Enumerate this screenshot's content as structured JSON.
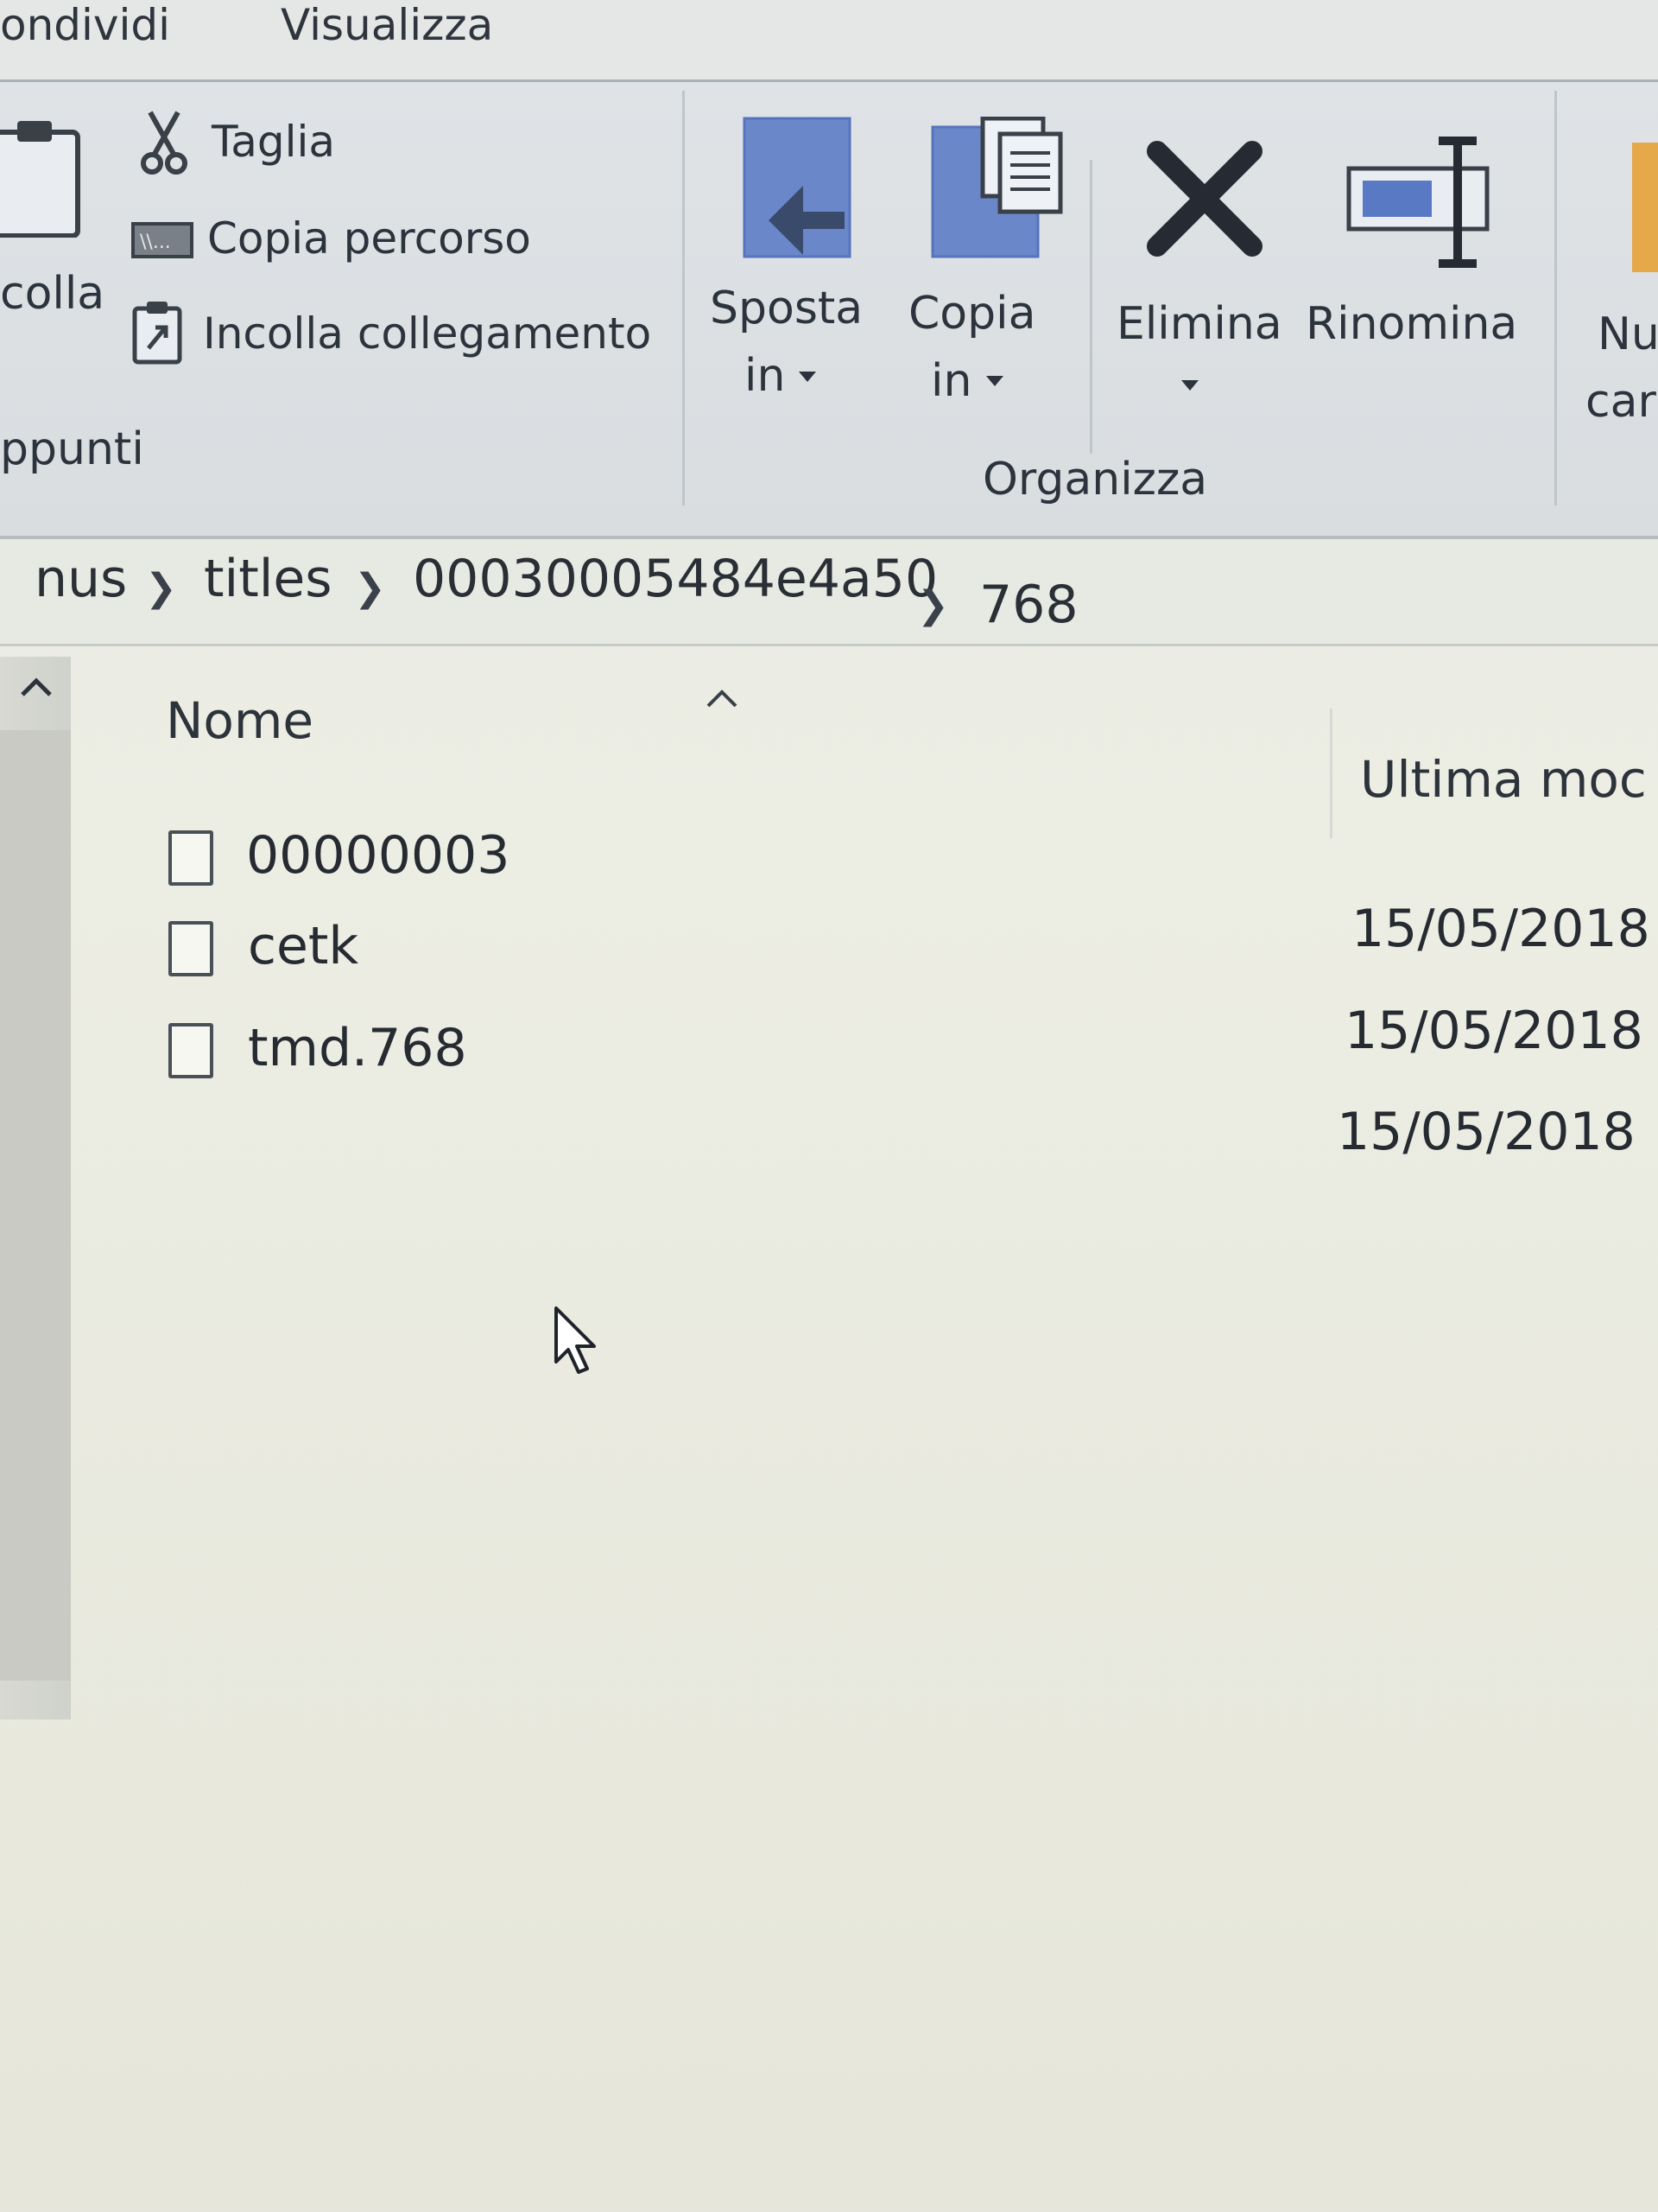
{
  "tabs": [
    {
      "label": "ondividi"
    },
    {
      "label": "Visualizza"
    }
  ],
  "ribbon": {
    "clipboard": {
      "paste_label": "colla",
      "cut_label": "Taglia",
      "copy_path_label": "Copia percorso",
      "paste_shortcut_label": "Incolla collegamento",
      "group_label": "ppunti"
    },
    "organize": {
      "move_to_label": "Sposta",
      "move_to_label2": "in",
      "copy_to_label": "Copia",
      "copy_to_label2": "in",
      "delete_label": "Elimina",
      "rename_label": "Rinomina",
      "group_label": "Organizza"
    },
    "new": {
      "new_folder_label": "Nu",
      "new_folder_label2": "car"
    }
  },
  "breadcrumb": [
    "nus",
    "titles",
    "00030005484e4a50",
    "768"
  ],
  "columns": {
    "name": "Nome",
    "modified": "Ultima moc"
  },
  "files": [
    {
      "name": "00000003",
      "modified": "15/05/2018"
    },
    {
      "name": "cetk",
      "modified": "15/05/2018"
    },
    {
      "name": "tmd.768",
      "modified": "15/05/2018"
    }
  ],
  "colors": {
    "accent_icon": "#5a79c4",
    "text": "#262b33",
    "background": "#ecede3"
  }
}
